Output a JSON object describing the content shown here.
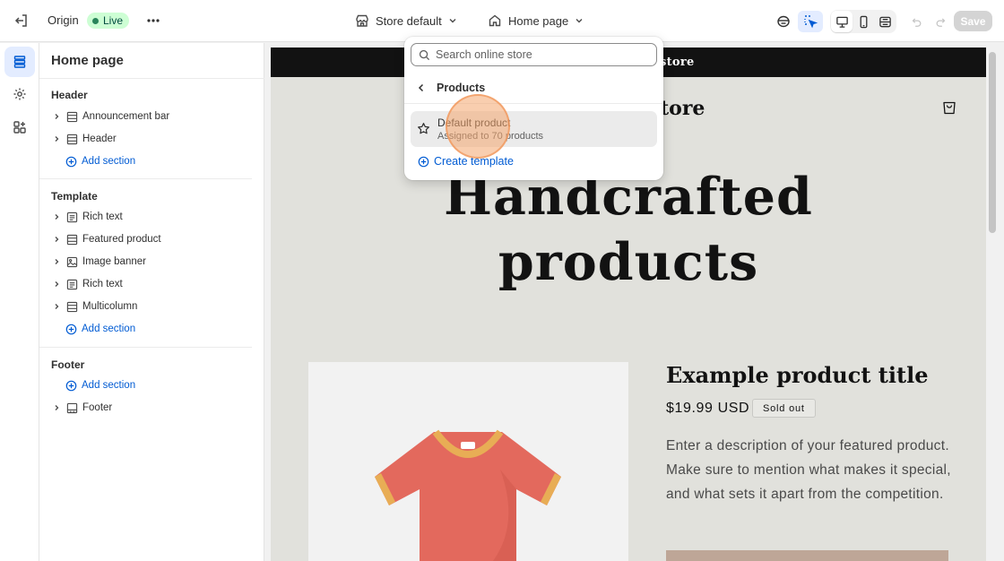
{
  "topbar": {
    "theme_name": "Origin",
    "status": "Live",
    "store_selector": "Store default",
    "page_selector": "Home page",
    "save_label": "Save"
  },
  "sidebar": {
    "title": "Home page",
    "groups": {
      "header": {
        "label": "Header",
        "items": [
          "Announcement bar",
          "Header"
        ],
        "add": "Add section"
      },
      "template": {
        "label": "Template",
        "items": [
          "Rich text",
          "Featured product",
          "Image banner",
          "Rich text",
          "Multicolumn"
        ],
        "add": "Add section"
      },
      "footer": {
        "label": "Footer",
        "add": "Add section",
        "items": [
          "Footer"
        ]
      }
    }
  },
  "dropdown": {
    "search_placeholder": "Search online store",
    "heading": "Products",
    "item": {
      "title": "Default product",
      "subtitle": "Assigned to 70 products"
    },
    "create": "Create template"
  },
  "preview": {
    "announcement": "store",
    "logo": "tore",
    "hero_line1": "Handcrafted",
    "hero_line2": "products",
    "product_title": "Example product title",
    "price": "$19.99 USD",
    "badge": "Sold out",
    "description": "Enter a description of your featured product. Make sure to mention what makes it special, and what sets it apart from the competition."
  },
  "colors": {
    "accent": "#005bd3",
    "live_bg": "#cdfed4",
    "live_dot": "#29845a",
    "preview_bg": "#e1e1dc",
    "tshirt": "#e3695d",
    "collar": "#e8ad55"
  },
  "icons": [
    "exit-icon",
    "more-icon",
    "store-icon",
    "home-icon",
    "chevron-down-icon",
    "inspector-icon",
    "selector-icon",
    "desktop-icon",
    "mobile-icon",
    "fullwidth-icon",
    "undo-icon",
    "redo-icon",
    "sections-icon",
    "settings-icon",
    "apps-icon",
    "search-icon",
    "chevron-left-icon",
    "star-icon",
    "plus-circle-icon",
    "cart-icon"
  ]
}
